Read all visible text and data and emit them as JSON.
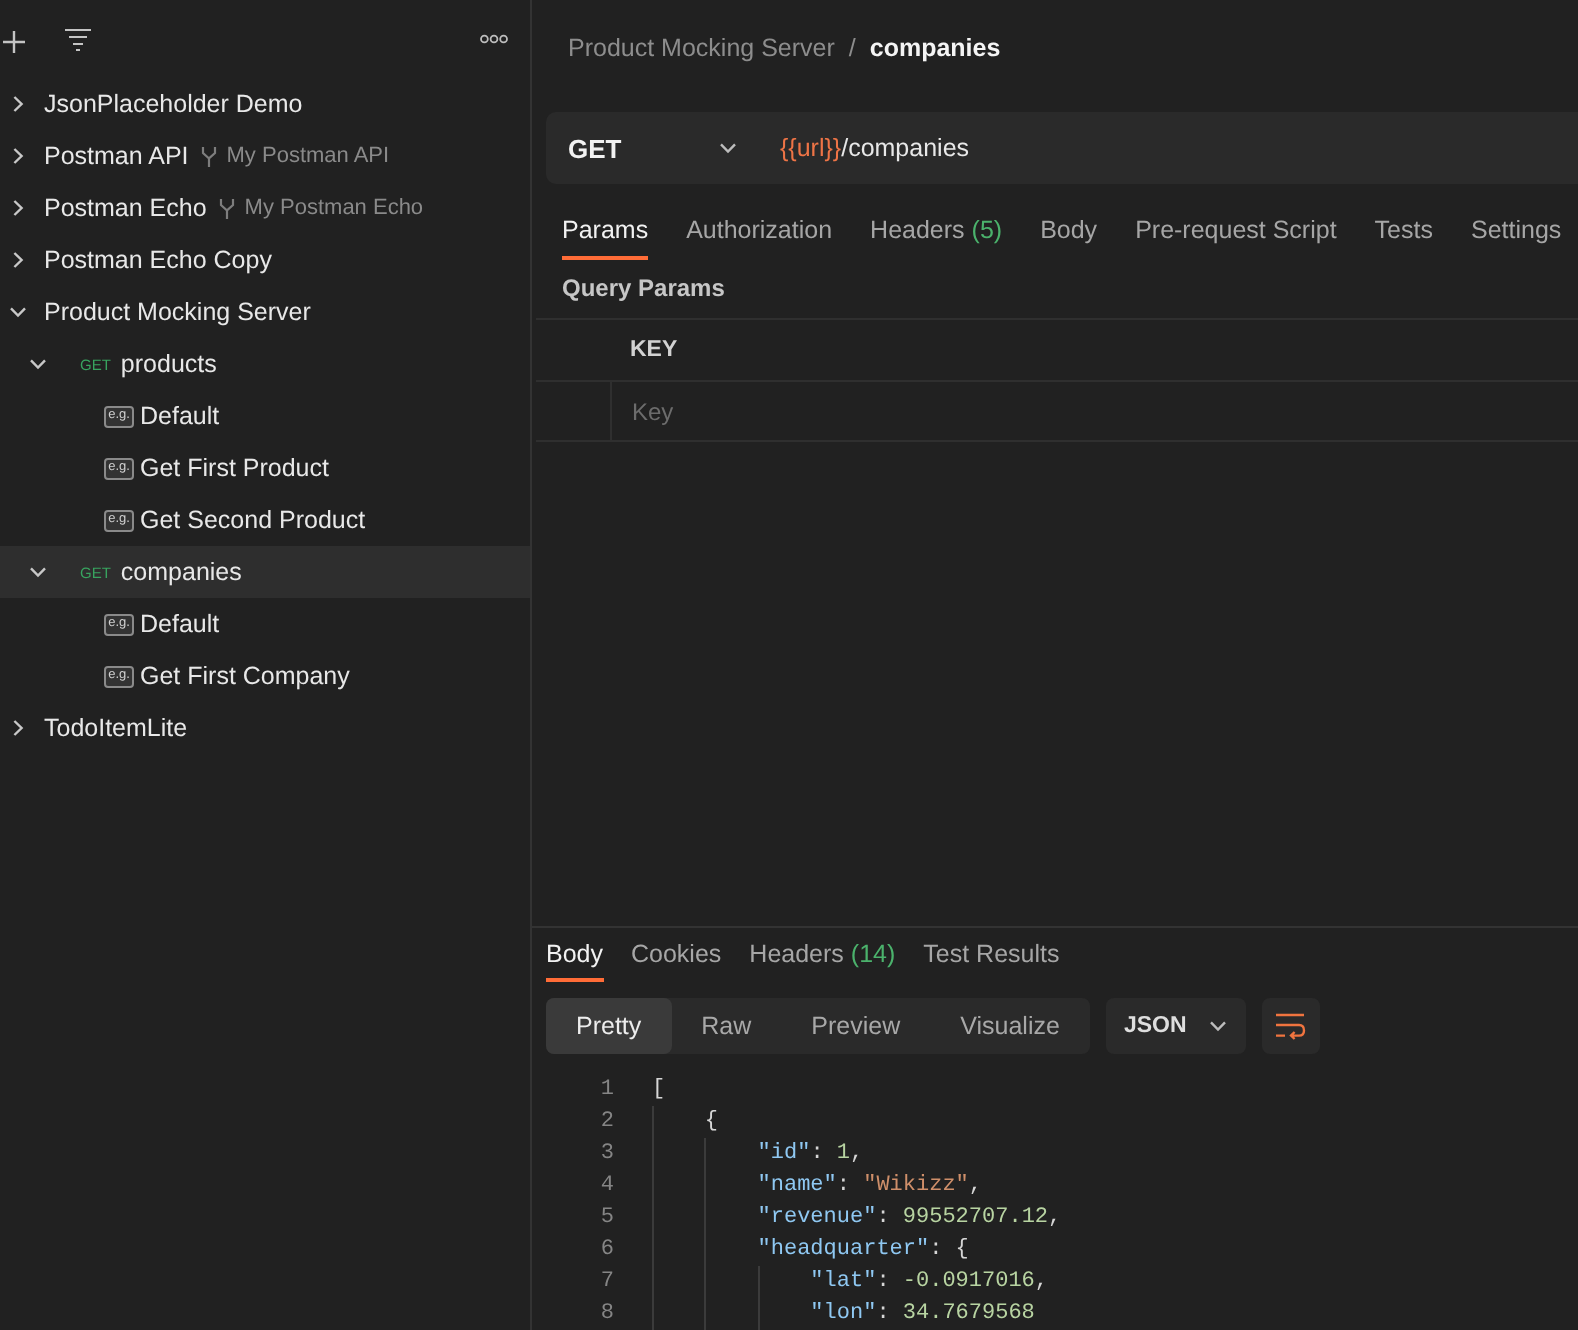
{
  "sidebar": {
    "tree": [
      {
        "kind": "collection",
        "name": "JsonPlaceholder Demo",
        "expanded": false,
        "selected": false
      },
      {
        "kind": "collection",
        "name": "Postman API",
        "fork": "My Postman API",
        "expanded": false,
        "selected": false
      },
      {
        "kind": "collection",
        "name": "Postman Echo",
        "fork": "My Postman Echo",
        "expanded": false,
        "selected": false
      },
      {
        "kind": "collection",
        "name": "Postman Echo Copy",
        "expanded": false,
        "selected": false
      },
      {
        "kind": "collection",
        "name": "Product Mocking Server",
        "expanded": true,
        "selected": false,
        "children": [
          {
            "kind": "request",
            "method": "GET",
            "name": "products",
            "expanded": true,
            "selected": false,
            "children": [
              {
                "kind": "example",
                "badge": "e.g.",
                "name": "Default",
                "selected": false
              },
              {
                "kind": "example",
                "badge": "e.g.",
                "name": "Get First Product",
                "selected": false
              },
              {
                "kind": "example",
                "badge": "e.g.",
                "name": "Get Second Product",
                "selected": false
              }
            ]
          },
          {
            "kind": "request",
            "method": "GET",
            "name": "companies",
            "expanded": true,
            "selected": true,
            "children": [
              {
                "kind": "example",
                "badge": "e.g.",
                "name": "Default",
                "selected": false
              },
              {
                "kind": "example",
                "badge": "e.g.",
                "name": "Get First Company",
                "selected": false
              }
            ]
          }
        ]
      },
      {
        "kind": "collection",
        "name": "TodoItemLite",
        "expanded": false,
        "selected": false
      }
    ]
  },
  "breadcrumb": {
    "parent": "Product Mocking Server",
    "separator": "/",
    "current": "companies"
  },
  "request": {
    "method": "GET",
    "url": [
      {
        "kind": "variable",
        "text": "{{url}}"
      },
      {
        "kind": "path",
        "text": "/companies"
      }
    ]
  },
  "request_tabs": [
    {
      "label": "Params",
      "selected": true
    },
    {
      "label": "Authorization",
      "selected": false
    },
    {
      "label": "Headers",
      "count": "(5)",
      "selected": false
    },
    {
      "label": "Body",
      "selected": false
    },
    {
      "label": "Pre-request Script",
      "selected": false
    },
    {
      "label": "Tests",
      "selected": false
    },
    {
      "label": "Settings",
      "selected": false
    }
  ],
  "query_params": {
    "title": "Query Params",
    "columns": [
      "KEY"
    ],
    "placeholder": "Key"
  },
  "response": {
    "tabs": [
      {
        "label": "Body",
        "selected": true
      },
      {
        "label": "Cookies",
        "selected": false
      },
      {
        "label": "Headers",
        "count": "(14)",
        "selected": false
      },
      {
        "label": "Test Results",
        "selected": false
      }
    ],
    "view_modes": [
      {
        "label": "Pretty",
        "selected": true
      },
      {
        "label": "Raw",
        "selected": false
      },
      {
        "label": "Preview",
        "selected": false
      },
      {
        "label": "Visualize",
        "selected": false
      }
    ],
    "format": "JSON",
    "code": [
      {
        "number": "1",
        "tokens": [
          {
            "kind": "punct",
            "text": "["
          }
        ],
        "children": [
          {
            "number": "2",
            "tokens": [
              {
                "kind": "punct",
                "text": "{"
              }
            ],
            "children": [
              {
                "number": "3",
                "tokens": [
                  {
                    "kind": "key",
                    "text": "\"id\""
                  },
                  {
                    "kind": "punct",
                    "text": ": "
                  },
                  {
                    "kind": "number",
                    "text": "1"
                  },
                  {
                    "kind": "punct",
                    "text": ","
                  }
                ]
              },
              {
                "number": "4",
                "tokens": [
                  {
                    "kind": "key",
                    "text": "\"name\""
                  },
                  {
                    "kind": "punct",
                    "text": ": "
                  },
                  {
                    "kind": "string",
                    "text": "\"Wikizz\""
                  },
                  {
                    "kind": "punct",
                    "text": ","
                  }
                ]
              },
              {
                "number": "5",
                "tokens": [
                  {
                    "kind": "key",
                    "text": "\"revenue\""
                  },
                  {
                    "kind": "punct",
                    "text": ": "
                  },
                  {
                    "kind": "number",
                    "text": "99552707.12"
                  },
                  {
                    "kind": "punct",
                    "text": ","
                  }
                ]
              },
              {
                "number": "6",
                "tokens": [
                  {
                    "kind": "key",
                    "text": "\"headquarter\""
                  },
                  {
                    "kind": "punct",
                    "text": ": {"
                  }
                ],
                "children": [
                  {
                    "number": "7",
                    "tokens": [
                      {
                        "kind": "key",
                        "text": "\"lat\""
                      },
                      {
                        "kind": "punct",
                        "text": ": "
                      },
                      {
                        "kind": "number",
                        "text": "-0.0917016"
                      },
                      {
                        "kind": "punct",
                        "text": ","
                      }
                    ]
                  },
                  {
                    "number": "8",
                    "tokens": [
                      {
                        "kind": "key",
                        "text": "\"lon\""
                      },
                      {
                        "kind": "punct",
                        "text": ": "
                      },
                      {
                        "kind": "number",
                        "text": "34.7679568"
                      }
                    ]
                  }
                ]
              }
            ]
          }
        ]
      }
    ]
  }
}
